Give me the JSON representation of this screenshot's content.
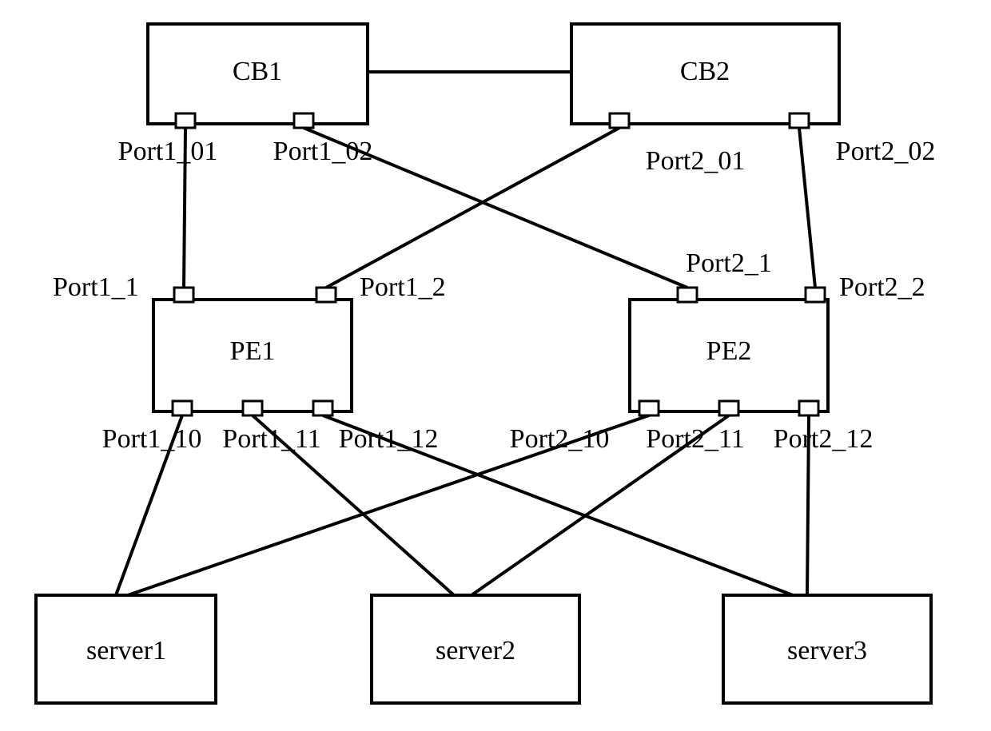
{
  "nodes": {
    "cb1": {
      "label": "CB1",
      "ports": {
        "p1_01": "Port1_01",
        "p1_02": "Port1_02"
      }
    },
    "cb2": {
      "label": "CB2",
      "ports": {
        "p2_01": "Port2_01",
        "p2_02": "Port2_02"
      }
    },
    "pe1": {
      "label": "PE1",
      "ports": {
        "p1_1": "Port1_1",
        "p1_2": "Port1_2",
        "p1_10": "Port1_10",
        "p1_11": "Port1_11",
        "p1_12": "Port1_12"
      }
    },
    "pe2": {
      "label": "PE2",
      "ports": {
        "p2_1": "Port2_1",
        "p2_2": "Port2_2",
        "p2_10": "Port2_10",
        "p2_11": "Port2_11",
        "p2_12": "Port2_12"
      }
    },
    "server1": {
      "label": "server1"
    },
    "server2": {
      "label": "server2"
    },
    "server3": {
      "label": "server3"
    }
  },
  "connections": [
    [
      "cb1",
      "cb2"
    ],
    [
      "cb1.p1_01",
      "pe1.p1_1"
    ],
    [
      "cb1.p1_02",
      "pe2.p2_1"
    ],
    [
      "cb2.p2_01",
      "pe1.p1_2"
    ],
    [
      "cb2.p2_02",
      "pe2.p2_2"
    ],
    [
      "pe1.p1_10",
      "server1"
    ],
    [
      "pe1.p1_11",
      "server2"
    ],
    [
      "pe1.p1_12",
      "server3"
    ],
    [
      "pe2.p2_10",
      "server1"
    ],
    [
      "pe2.p2_11",
      "server2"
    ],
    [
      "pe2.p2_12",
      "server3"
    ]
  ]
}
